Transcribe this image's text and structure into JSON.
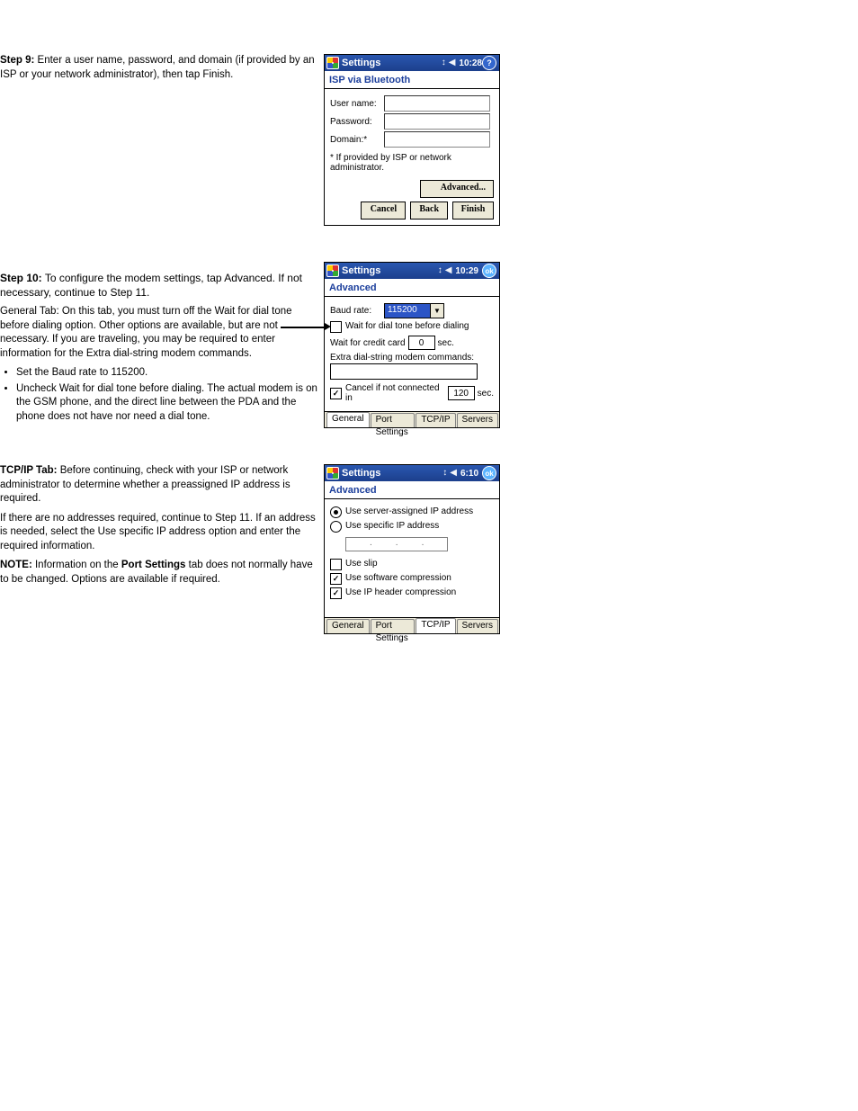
{
  "step9": {
    "instruction": "Enter a user name, password, and domain (if provided by an ISP or your network administrator), then tap Finish."
  },
  "screen1": {
    "title": "Settings",
    "time": "10:28",
    "heading": "ISP via Bluetooth",
    "fields": {
      "username_label": "User name:",
      "password_label": "Password:",
      "domain_label": "Domain:*"
    },
    "footnote": "* If provided by ISP or network administrator.",
    "buttons": {
      "advanced": "Advanced...",
      "cancel": "Cancel",
      "back": "Back",
      "finish": "Finish"
    }
  },
  "step10": {
    "title": "Step 10:",
    "text": "To configure the modem settings, tap Advanced. If not necessary, continue to Step 11.",
    "tab_general": "General Tab: On this tab, you must turn off the Wait for dial tone before dialing option. Other options are available, but are not necessary. If you are traveling, you may be required to enter information for the Extra dial-string modem commands.",
    "bullet1": "Set the Baud rate to 115200.",
    "bullet2": "Uncheck Wait for dial tone before dialing. The actual modem is on the GSM phone, and the direct line between the PDA and the phone does not have nor need a dial tone."
  },
  "screen2": {
    "title": "Settings",
    "time": "10:29",
    "ok": "ok",
    "heading": "Advanced",
    "baud_label": "Baud rate:",
    "baud_value": "115200",
    "wait_dial": "Wait for dial tone before dialing",
    "wait_credit_pre": "Wait for credit card",
    "wait_credit_val": "0",
    "wait_credit_post": "sec.",
    "extra_label": "Extra dial-string modem commands:",
    "cancel_if_pre": "Cancel if not connected in",
    "cancel_if_val": "120",
    "cancel_if_post": "sec.",
    "tabs": {
      "t1": "General",
      "t2": "Port Settings",
      "t3": "TCP/IP",
      "t4": "Servers"
    }
  },
  "tcpip_text": {
    "p1": "TCP/IP Tab: Before continuing, check with your ISP or network administrator to determine whether a preassigned IP address is required.",
    "p2": "If there are no addresses required, continue to Step 11. If an address is needed, select the Use specific IP address option and enter the required information.",
    "p3": "NOTE: Information on the Port Settings tab does not normally have to be changed. Options are available if required."
  },
  "screen3": {
    "title": "Settings",
    "time": "6:10",
    "ok": "ok",
    "heading": "Advanced",
    "opt_server": "Use server-assigned IP address",
    "opt_specific": "Use specific IP address",
    "chk_slip": "Use slip",
    "chk_sw": "Use software compression",
    "chk_ip": "Use IP header compression",
    "tabs": {
      "t1": "General",
      "t2": "Port Settings",
      "t3": "TCP/IP",
      "t4": "Servers"
    }
  }
}
